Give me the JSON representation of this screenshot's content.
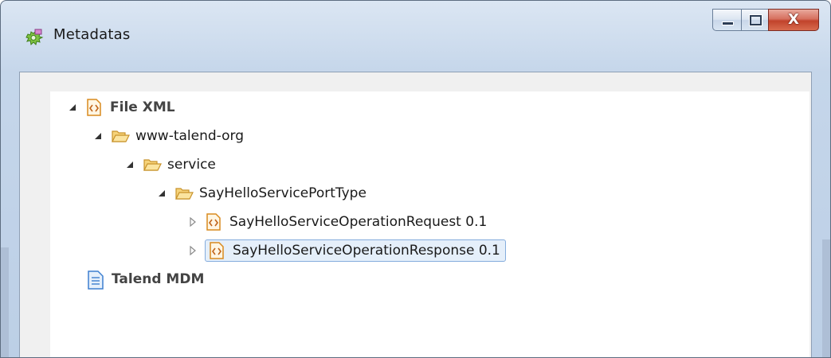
{
  "window": {
    "title": "Metadatas",
    "app_icon": "metadata-gear-icon",
    "buttons": {
      "minimize": "minimize-icon",
      "maximize": "maximize-icon",
      "close_label": "X"
    }
  },
  "tree": {
    "nodes": [
      {
        "label": "File XML",
        "icon": "xml-file-icon",
        "expanded": true,
        "bold": true
      },
      {
        "label": "www-talend-org",
        "icon": "folder-open-icon",
        "expanded": true
      },
      {
        "label": "service",
        "icon": "folder-open-icon",
        "expanded": true
      },
      {
        "label": "SayHelloServicePortType",
        "icon": "folder-open-icon",
        "expanded": true
      },
      {
        "label": "SayHelloServiceOperationRequest 0.1",
        "icon": "xml-file-icon",
        "expanded": false
      },
      {
        "label": "SayHelloServiceOperationResponse 0.1",
        "icon": "xml-file-icon",
        "expanded": false,
        "selected": true
      },
      {
        "label": "Talend MDM",
        "icon": "document-icon",
        "bold": true
      }
    ]
  },
  "colors": {
    "selection_border": "#84acdd",
    "selection_fill": "#e5effa",
    "close_button": "#c1432c",
    "xml_icon_orange": "#e8a23a"
  }
}
